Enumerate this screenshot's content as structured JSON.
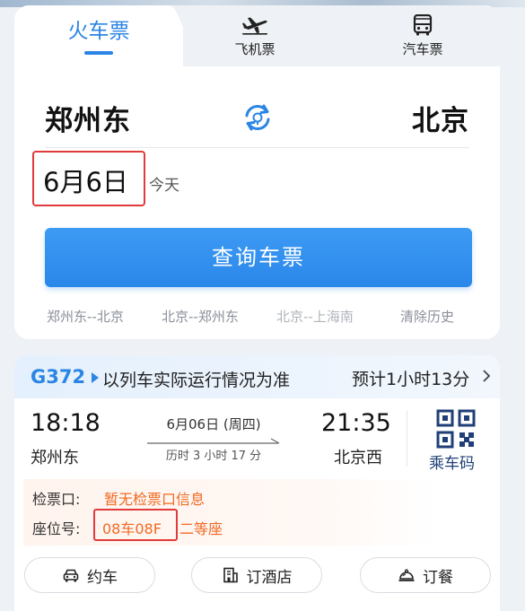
{
  "tabs": {
    "train": "火车票",
    "plane": "飞机票",
    "bus": "汽车票"
  },
  "search": {
    "from_station": "郑州东",
    "to_station": "北京",
    "date": "6月6日",
    "date_note": "今天",
    "query_button": "查询车票",
    "history": [
      "郑州东--北京",
      "北京--郑州东",
      "北京--上海南"
    ],
    "clear_history": "清除历史"
  },
  "ticket": {
    "train_no": "G372",
    "marquee": "以列车实际运行情况为准",
    "duration_header": "预计1小时13分",
    "departure_time": "18:18",
    "departure_station": "郑州东",
    "travel_date": "6月06日 (周四)",
    "travel_duration": "历时 3 小时 17 分",
    "arrival_time": "21:35",
    "arrival_station": "北京西",
    "qr_label": "乘车码",
    "gate_label": "检票口:",
    "gate_value": "暂无检票口信息",
    "seat_label": "座位号:",
    "seat_value": "08车08F",
    "seat_class": "二等座"
  },
  "actions": {
    "car": "约车",
    "hotel": "订酒店",
    "meal": "订餐"
  },
  "colors": {
    "accent": "#2b85e4",
    "highlight_box": "#e03a3a",
    "info_orange": "#f06a22",
    "qr_navy": "#1f3f78"
  }
}
